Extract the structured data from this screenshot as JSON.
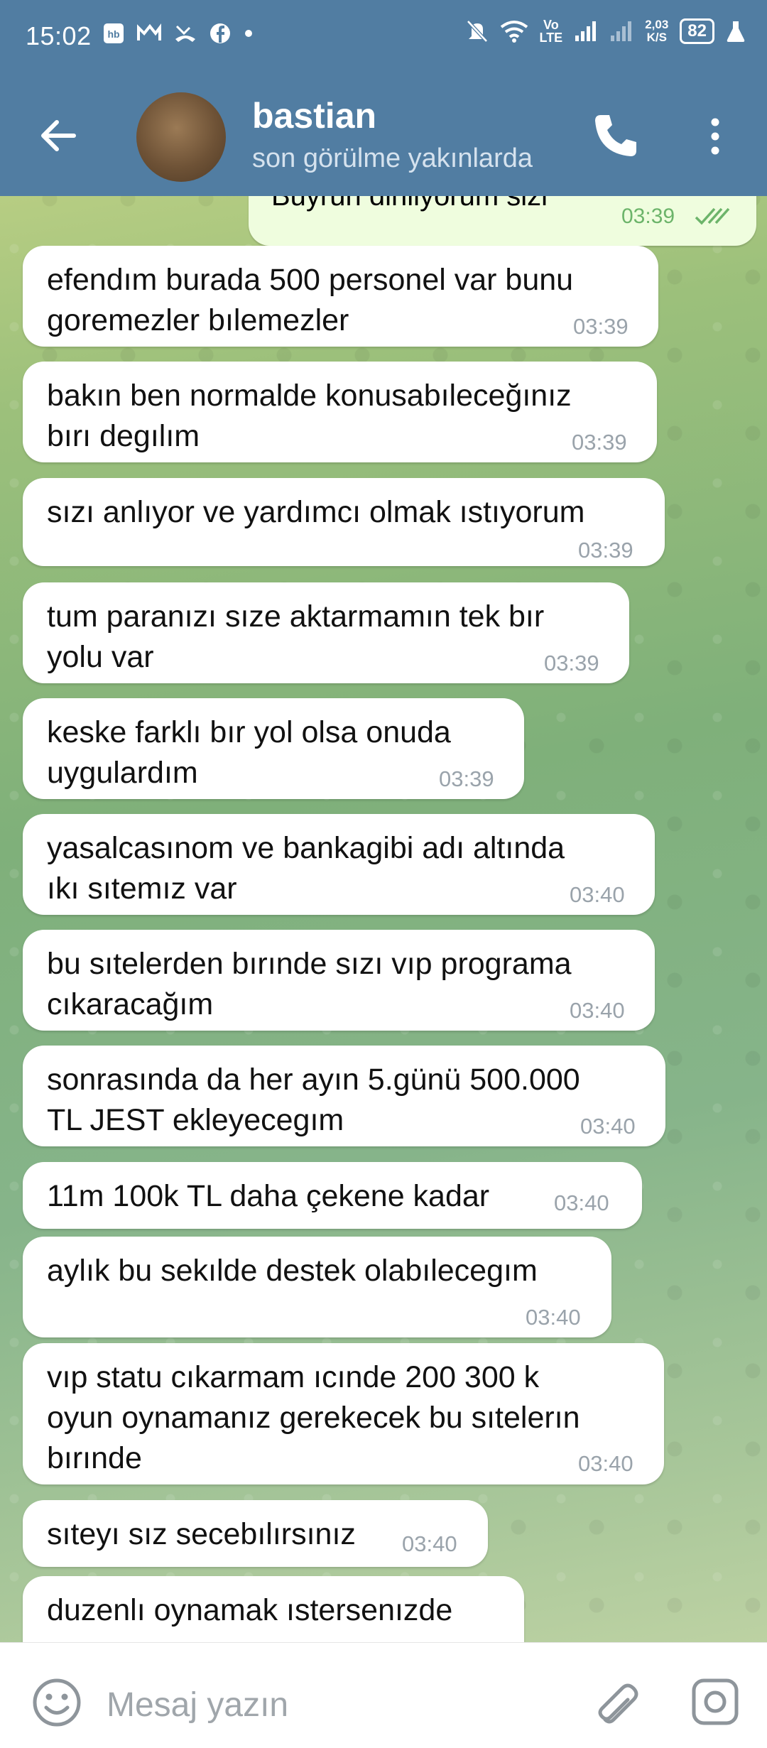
{
  "status_bar": {
    "time": "15:02",
    "left_icons": [
      "hb-app-icon",
      "maps-icon",
      "missed-call-icon",
      "facebook-icon",
      "dot-icon"
    ],
    "right_icons": [
      "mute-icon",
      "wifi-icon",
      "volte-icon",
      "signal-icon",
      "signal-weak-icon"
    ],
    "volte": "Vo\nLTE",
    "speed": "2,03\nK/S",
    "battery": "82"
  },
  "header": {
    "contact_name": "bastian",
    "last_seen": "son görülme yakınlarda"
  },
  "outgoing": {
    "text": "Buyrun dinliyorum sizi",
    "time": "03:39"
  },
  "messages": [
    {
      "text": "efendım burada 500 personel var bunu\ngoremezler bılemezler",
      "time": "03:39"
    },
    {
      "text": "bakın ben normalde konusabıleceğınız\nbırı degılım",
      "time": "03:39"
    },
    {
      "text": "sızı anlıyor ve yardımcı olmak ıstıyorum",
      "time": "03:39"
    },
    {
      "text": "tum paranızı sıze aktarmamın tek bır\nyolu var",
      "time": "03:39"
    },
    {
      "text": "keske farklı bır yol olsa onuda\nuygulardım",
      "time": "03:39"
    },
    {
      "text": "yasalcasınom ve bankagibi adı altında\nıkı sıtemız var",
      "time": "03:40"
    },
    {
      "text": "bu sıtelerden bırınde sızı vıp programa\ncıkaracağım",
      "time": "03:40"
    },
    {
      "text": "sonrasında da her ayın 5.günü 500.000\nTL JEST ekleyecegım",
      "time": "03:40"
    },
    {
      "text": "11m 100k TL daha çekene kadar",
      "time": "03:40"
    },
    {
      "text": "aylık bu sekılde destek olabılecegım",
      "time": "03:40"
    },
    {
      "text": "vıp statu cıkarmam ıcınde 200 300 k\noyun oynamanız gerekecek bu sıtelerın\nbırınde",
      "time": "03:40"
    },
    {
      "text": "sıteyı sız secebılırsınız",
      "time": "03:40"
    },
    {
      "text": "duzenlı oynamak ıstersenızde",
      "time": ""
    }
  ],
  "input": {
    "placeholder": "Mesaj yazın"
  }
}
